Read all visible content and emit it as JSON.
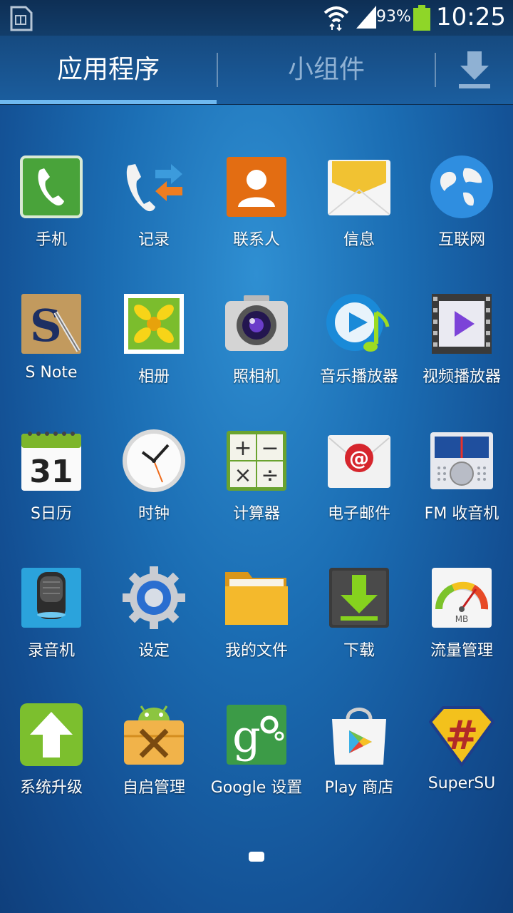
{
  "status_bar": {
    "battery_percent": "93%",
    "time": "10:25"
  },
  "tabs": {
    "apps": "应用程序",
    "widgets": "小组件"
  },
  "apps": [
    {
      "label": "手机",
      "icon": "phone-icon"
    },
    {
      "label": "记录",
      "icon": "call-log-icon"
    },
    {
      "label": "联系人",
      "icon": "contacts-icon"
    },
    {
      "label": "信息",
      "icon": "messages-icon"
    },
    {
      "label": "互联网",
      "icon": "globe-icon"
    },
    {
      "label": "S Note",
      "icon": "s-note-icon"
    },
    {
      "label": "相册",
      "icon": "gallery-icon"
    },
    {
      "label": "照相机",
      "icon": "camera-icon"
    },
    {
      "label": "音乐播放器",
      "icon": "music-player-icon"
    },
    {
      "label": "视频播放器",
      "icon": "video-player-icon"
    },
    {
      "label": "S日历",
      "icon": "calendar-icon",
      "calendar_day": "31"
    },
    {
      "label": "时钟",
      "icon": "clock-icon"
    },
    {
      "label": "计算器",
      "icon": "calculator-icon"
    },
    {
      "label": "电子邮件",
      "icon": "email-icon"
    },
    {
      "label": "FM 收音机",
      "icon": "fm-radio-icon"
    },
    {
      "label": "录音机",
      "icon": "voice-recorder-icon"
    },
    {
      "label": "设定",
      "icon": "settings-gear-icon"
    },
    {
      "label": "我的文件",
      "icon": "folder-icon"
    },
    {
      "label": "下载",
      "icon": "download-icon"
    },
    {
      "label": "流量管理",
      "icon": "data-usage-gauge-icon",
      "gauge_text": "MB"
    },
    {
      "label": "系统升级",
      "icon": "system-update-icon"
    },
    {
      "label": "自启管理",
      "icon": "autostart-manager-icon"
    },
    {
      "label": "Google 设置",
      "icon": "google-settings-icon"
    },
    {
      "label": "Play 商店",
      "icon": "play-store-icon"
    },
    {
      "label": "SuperSU",
      "icon": "supersu-icon"
    }
  ],
  "colors": {
    "accent": "#6fb9f0",
    "background": "#1b6db3",
    "battery": "#8fd628"
  }
}
